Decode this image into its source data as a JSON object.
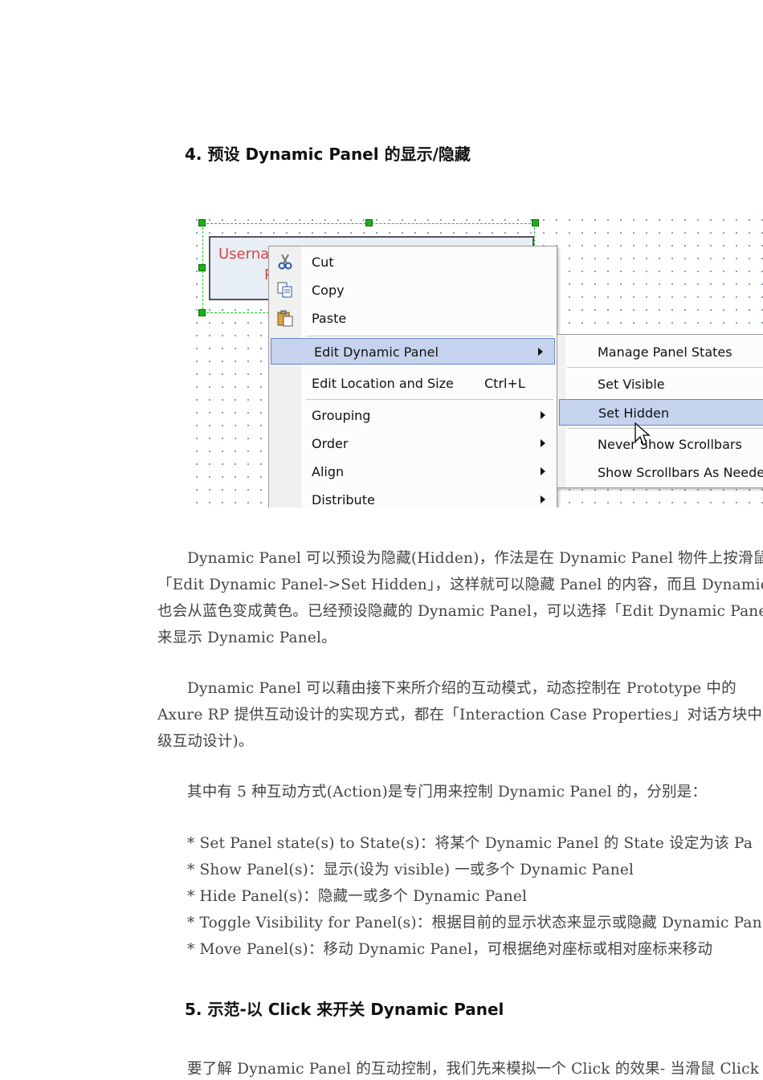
{
  "section4": {
    "heading": "4. 预设 Dynamic Panel 的显示/隐藏"
  },
  "screenshot": {
    "widget_text": "Userna",
    "widget_text2": "P",
    "menu": {
      "items": [
        {
          "label": "Cut",
          "icon": "scissors-icon"
        },
        {
          "label": "Copy",
          "icon": "copy-icon"
        },
        {
          "label": "Paste",
          "icon": "paste-icon"
        },
        {
          "label": "Edit Dynamic Panel"
        },
        {
          "label": "Edit Location and Size",
          "shortcut": "Ctrl+L"
        },
        {
          "label": "Grouping"
        },
        {
          "label": "Order"
        },
        {
          "label": "Align"
        },
        {
          "label": "Distribute"
        }
      ]
    },
    "submenu": {
      "items": [
        {
          "label": "Manage Panel States"
        },
        {
          "label": "Set Visible"
        },
        {
          "label": "Set Hidden"
        },
        {
          "label": "Never Show Scrollbars"
        },
        {
          "label": "Show Scrollbars As Needed"
        }
      ]
    },
    "highlight_color": "#c5d3ee"
  },
  "paragraphs": {
    "p1": [
      "Dynamic Panel 可以预设为隐藏(Hidden)，作法是在 Dynamic Panel 物件上按滑鼠",
      "「Edit Dynamic Panel->Set Hidden」，这样就可以隐藏 Panel 的内容，而且 Dynamic",
      "也会从蓝色变成黄色。已经预设隐藏的 Dynamic Panel，可以选择「Edit Dynamic Panel->",
      "来显示 Dynamic Panel。"
    ],
    "p2": [
      "Dynamic Panel 可以藉由接下来所介绍的互动模式，动态控制在 Prototype 中的",
      "Axure RP 提供互动设计的实现方式，都在「Interaction Case Properties」对话方块中",
      "级互动设计)。"
    ],
    "p3": "其中有 5 种互动方式(Action)是专门用来控制 Dynamic Panel 的，分别是：",
    "actions": [
      "* Set Panel state(s) to State(s)：将某个 Dynamic Panel 的 State 设定为该 Pa",
      "* Show Panel(s)：显示(设为 visible) 一或多个 Dynamic Panel",
      "* Hide Panel(s)：隐藏一或多个 Dynamic Panel",
      "* Toggle Visibility for Panel(s)：根据目前的显示状态来显示或隐藏 Dynamic Pan",
      "* Move Panel(s)：移动 Dynamic Panel，可根据绝对座标或相对座标来移动"
    ]
  },
  "section5": {
    "heading": "5. 示范-以 Click 来开关 Dynamic Panel",
    "intro": "要了解 Dynamic Panel 的互动控制，我们先来模拟一个 Click 的效果- 当滑鼠 Click 页"
  }
}
